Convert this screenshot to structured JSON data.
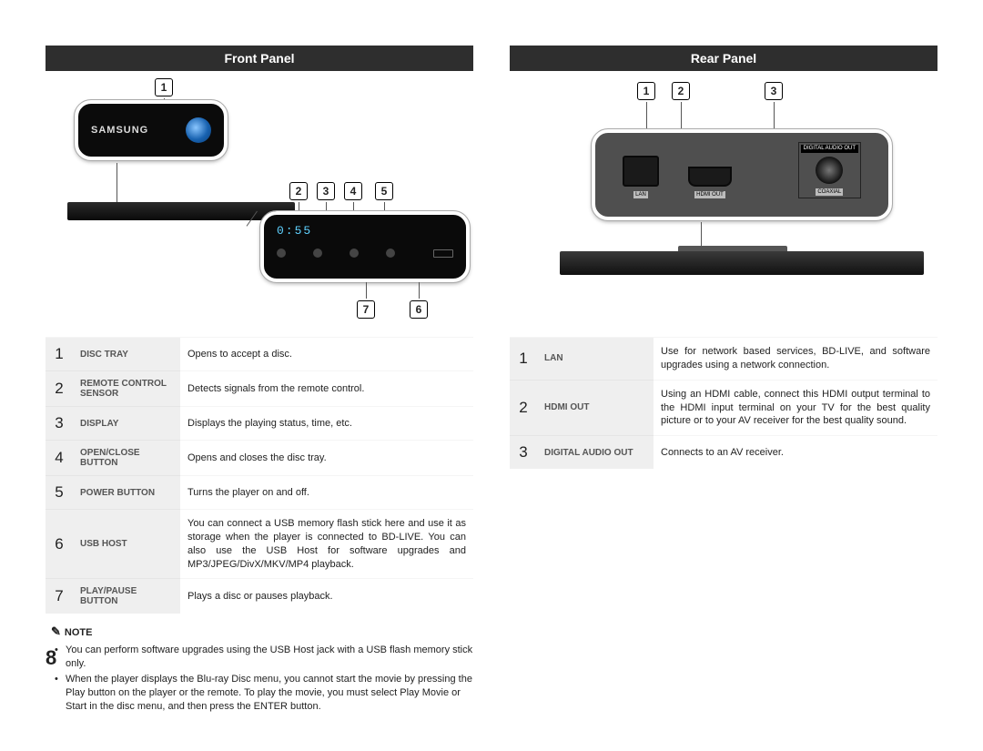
{
  "page_number": "8",
  "front": {
    "header": "Front Panel",
    "illus": {
      "brand": "SAMSUNG",
      "display": "0:55"
    },
    "callouts": [
      "1",
      "2",
      "3",
      "4",
      "5",
      "6",
      "7"
    ],
    "table": [
      {
        "num": "1",
        "name": "DISC TRAY",
        "desc": "Opens to accept a disc."
      },
      {
        "num": "2",
        "name": "REMOTE CONTROL SENSOR",
        "desc": "Detects signals from the remote control."
      },
      {
        "num": "3",
        "name": "DISPLAY",
        "desc": "Displays the playing status, time, etc."
      },
      {
        "num": "4",
        "name": "OPEN/CLOSE BUTTON",
        "desc": "Opens and closes the disc tray."
      },
      {
        "num": "5",
        "name": "POWER BUTTON",
        "desc": "Turns the player on and off."
      },
      {
        "num": "6",
        "name": "USB HOST",
        "desc": "You can connect a USB memory flash stick here and use it as storage when the player is connected to BD-LIVE. You can also use the USB Host for software upgrades and MP3/JPEG/DivX/MKV/MP4 playback."
      },
      {
        "num": "7",
        "name": "PLAY/PAUSE BUTTON",
        "desc": "Plays a disc or pauses playback."
      }
    ]
  },
  "rear": {
    "header": "Rear Panel",
    "callouts": [
      "1",
      "2",
      "3"
    ],
    "ports": {
      "lan": "LAN",
      "hdmi": "HDMI OUT",
      "audio_head": "DIGITAL\nAUDIO OUT",
      "coax": "COAXIAL"
    },
    "table": [
      {
        "num": "1",
        "name": "LAN",
        "desc": "Use for network based services, BD-LIVE, and software upgrades using a network connection."
      },
      {
        "num": "2",
        "name": "HDMI OUT",
        "desc": "Using an HDMI cable, connect this HDMI output terminal to the HDMI input terminal on your TV for the best quality picture or to your AV receiver for the best quality sound."
      },
      {
        "num": "3",
        "name": "DIGITAL AUDIO OUT",
        "desc": "Connects to an AV receiver."
      }
    ]
  },
  "note": {
    "label": "NOTE",
    "items": [
      "You can perform software upgrades using the USB Host jack with a USB flash memory stick only.",
      "When the player displays the Blu‑ray Disc menu, you cannot start the movie by pressing the Play button on the player or the remote. To play the movie, you must select Play Movie or Start in the disc menu, and then press the ENTER button."
    ]
  }
}
